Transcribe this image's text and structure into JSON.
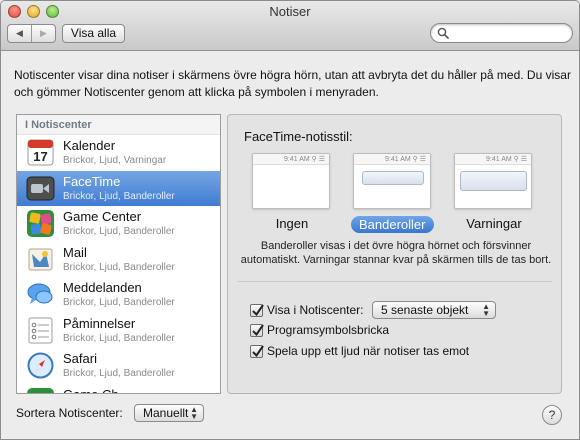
{
  "window": {
    "title": "Notiser"
  },
  "toolbar": {
    "back_label": "◀",
    "forward_label": "▶",
    "show_all_label": "Visa alla",
    "search_placeholder": ""
  },
  "description": "Notiscenter visar dina notiser i skärmens övre högra hörn, utan att avbryta det du håller på med. Du visar och gömmer Notiscenter genom att klicka på symbolen i menyraden.",
  "sidebar": {
    "header": "I Notiscenter",
    "selected_index": 1,
    "items": [
      {
        "name": "Kalender",
        "sub": "Brickor, Ljud, Varningar",
        "icon": "calendar-icon"
      },
      {
        "name": "FaceTime",
        "sub": "Brickor, Ljud, Banderoller",
        "icon": "facetime-icon"
      },
      {
        "name": "Game Center",
        "sub": "Brickor, Ljud, Banderoller",
        "icon": "game-center-icon"
      },
      {
        "name": "Mail",
        "sub": "Brickor, Ljud, Banderoller",
        "icon": "mail-icon"
      },
      {
        "name": "Meddelanden",
        "sub": "Brickor, Ljud, Banderoller",
        "icon": "messages-icon"
      },
      {
        "name": "Påminnelser",
        "sub": "Brickor, Ljud, Banderoller",
        "icon": "reminders-icon"
      },
      {
        "name": "Safari",
        "sub": "Brickor, Ljud, Banderoller",
        "icon": "safari-icon"
      },
      {
        "name": "Game Ch…",
        "sub": "",
        "icon": "game-center-icon"
      }
    ]
  },
  "panel": {
    "title": "FaceTime-notisstil:",
    "preview_time": "9:41 AM",
    "calendar_day": "17",
    "styles": [
      {
        "label": "Ingen",
        "selected": false
      },
      {
        "label": "Banderoller",
        "selected": true
      },
      {
        "label": "Varningar",
        "selected": false
      }
    ],
    "style_description": "Banderoller visas i det övre högra hörnet och försvinner automatiskt. Varningar stannar kvar på skärmen tills de tas bort.",
    "options": {
      "show_in_nc_label": "Visa i Notiscenter:",
      "show_in_nc_checked": true,
      "recent_items_value": "5 senaste objekt",
      "badge_label": "Programsymbolsbricka",
      "badge_checked": true,
      "sound_label": "Spela upp ett ljud när notiser tas emot",
      "sound_checked": true
    }
  },
  "footer": {
    "sort_label": "Sortera Notiscenter:",
    "sort_value": "Manuellt",
    "help_label": "?"
  },
  "colors": {
    "selection": "#3f7cd3",
    "background": "#ececec"
  }
}
